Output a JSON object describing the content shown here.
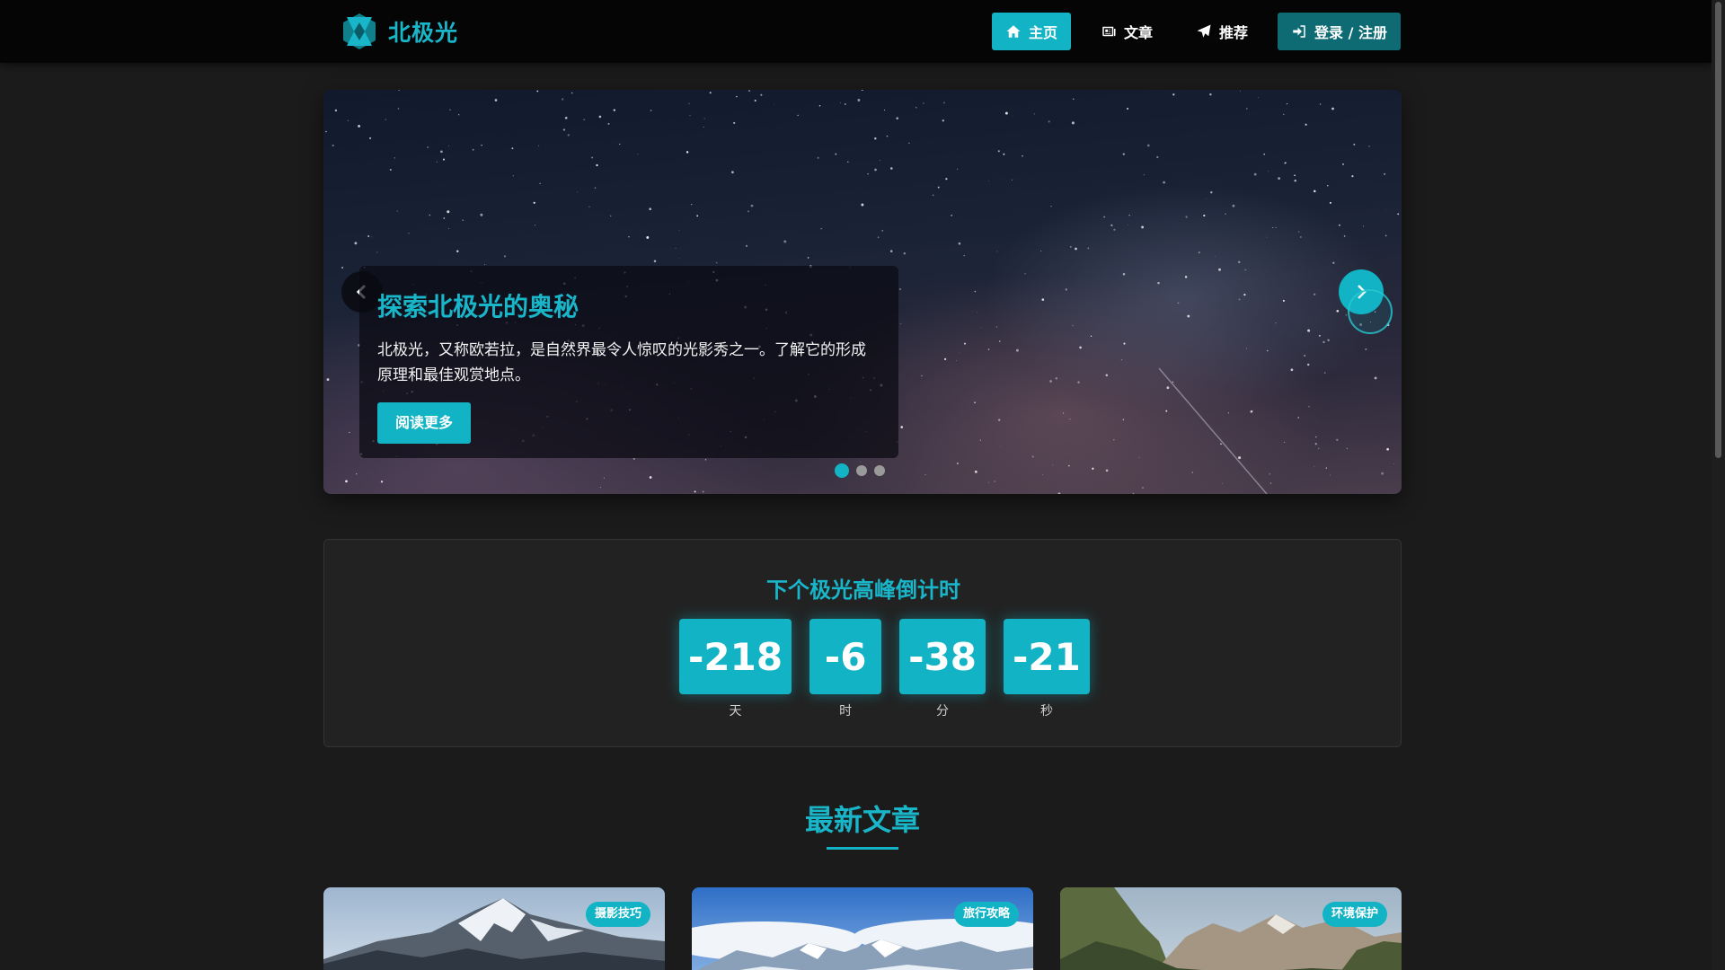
{
  "navbar": {
    "brand": "北极光",
    "items": [
      {
        "label": "主页",
        "icon": "home-icon",
        "active": true
      },
      {
        "label": "文章",
        "icon": "newspaper-icon"
      },
      {
        "label": "推荐",
        "icon": "paper-plane-icon"
      },
      {
        "label": "登录 / 注册",
        "icon": "sign-in-icon"
      }
    ]
  },
  "hero": {
    "title": "探索北极光的奥秘",
    "text": "北极光，又称欧若拉，是自然界最令人惊叹的光影秀之一。了解它的形成原理和最佳观赏地点。",
    "button": "阅读更多",
    "slide_count": 3,
    "active_slide": 1
  },
  "countdown": {
    "title": "下个极光高峰倒计时",
    "units": [
      {
        "value": "-218",
        "label": "天"
      },
      {
        "value": "-6",
        "label": "时"
      },
      {
        "value": "-38",
        "label": "分"
      },
      {
        "value": "-21",
        "label": "秒"
      }
    ]
  },
  "articles": {
    "title": "最新文章",
    "cards": [
      {
        "badge": "摄影技巧"
      },
      {
        "badge": "旅行攻略"
      },
      {
        "badge": "环境保护"
      }
    ]
  },
  "colors": {
    "accent": "#12b3c4",
    "accent_text": "#19b5c9",
    "background": "#1b1b1b",
    "navbar": "#050505"
  }
}
